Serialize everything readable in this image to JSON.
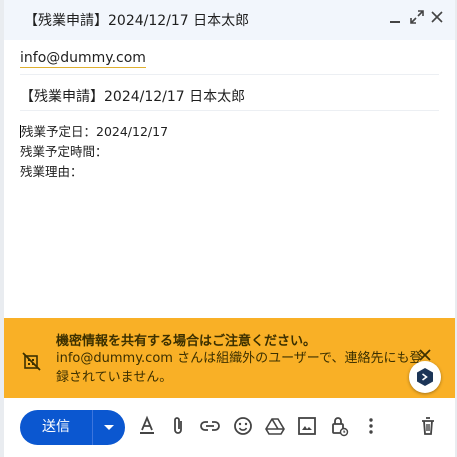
{
  "window": {
    "title": "【残業申請】2024/12/17 日本太郎",
    "controls": [
      "minimize-icon",
      "expand-icon",
      "close-icon"
    ]
  },
  "compose": {
    "to": "info@dummy.com",
    "subject": "【残業申請】2024/12/17 日本太郎",
    "body_lines": [
      "残業予定日：2024/12/17",
      "残業予定時間：",
      "残業理由："
    ]
  },
  "warning": {
    "title": "機密情報を共有する場合はご注意ください。",
    "message": "info@dummy.com さんは組織外のユーザーで、連絡先にも登録されていません。",
    "icon": "no-contact-icon",
    "color": "#f9b026"
  },
  "toolbar": {
    "send_label": "送信",
    "send_color": "#0b57d0",
    "icons": [
      "format-text-icon",
      "attach-icon",
      "link-icon",
      "emoji-icon",
      "drive-icon",
      "image-icon",
      "lock-clock-icon",
      "more-icon",
      "trash-icon"
    ]
  }
}
